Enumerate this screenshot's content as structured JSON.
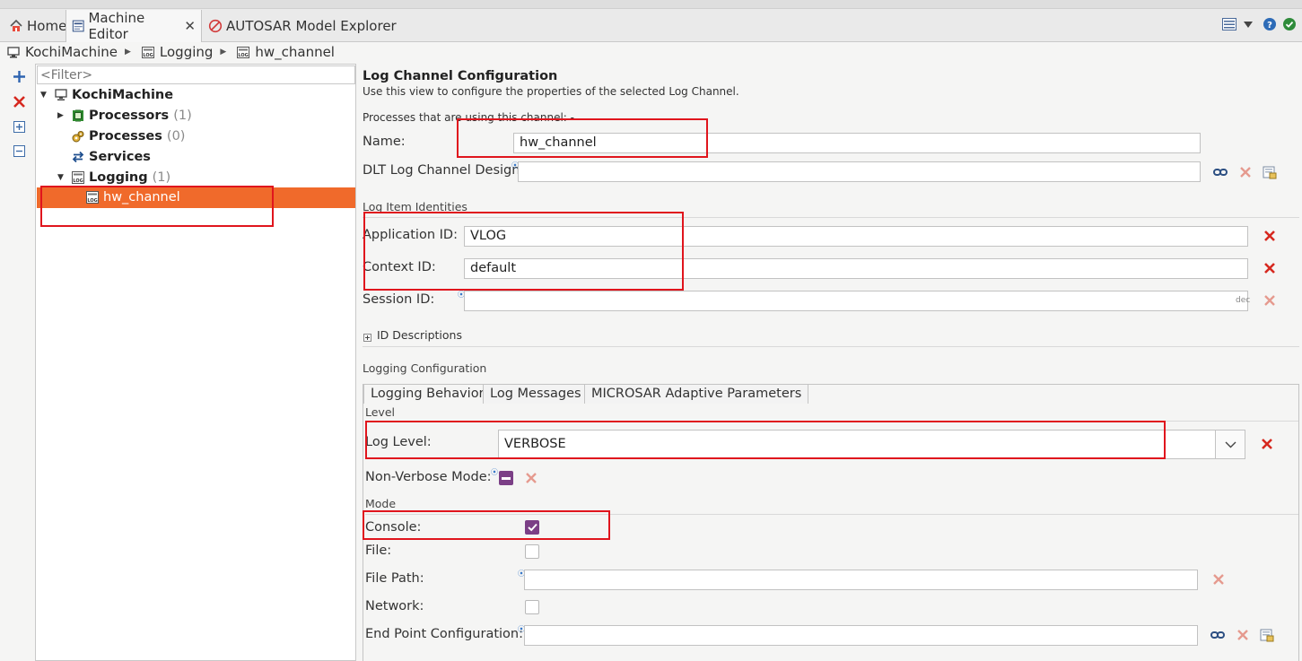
{
  "tabs": [
    {
      "label": "Home",
      "icon": "home-icon"
    },
    {
      "label": "Machine Editor",
      "icon": "machine-editor-icon",
      "close": "✕"
    },
    {
      "label": "AUTOSAR Model Explorer",
      "icon": "autosar-explorer-icon"
    }
  ],
  "breadcrumb": [
    "KochiMachine",
    "Logging",
    "hw_channel"
  ],
  "tree": {
    "filter_placeholder": "<Filter>",
    "root": {
      "label": "KochiMachine"
    },
    "items": [
      {
        "label": "Processors",
        "count": "(1)"
      },
      {
        "label": "Processes",
        "count": "(0)"
      },
      {
        "label": "Services",
        "count": ""
      },
      {
        "label": "Logging",
        "count": "(1)"
      }
    ],
    "selected": {
      "label": "hw_channel"
    }
  },
  "config": {
    "title": "Log Channel Configuration",
    "subtitle": "Use this view to configure the properties of the selected Log Channel.",
    "processes_note": "Processes that are using this channel: -",
    "name_label": "Name:",
    "name_value": "hw_channel",
    "dlt_label": "DLT Log Channel Design:",
    "dlt_value": "",
    "log_item_section": "Log Item Identities",
    "app_id_label": "Application ID:",
    "app_id_value": "VLOG",
    "context_id_label": "Context ID:",
    "context_id_value": "default",
    "session_id_label": "Session ID:",
    "session_id_value": "",
    "session_suffix": "dec",
    "id_descriptions": "ID Descriptions",
    "logging_section": "Logging Configuration"
  },
  "subtabs": [
    "Logging Behavior",
    "Log Messages",
    "MICROSAR Adaptive Parameters"
  ],
  "behavior": {
    "level_section": "Level",
    "log_level_label": "Log Level:",
    "log_level_value": "VERBOSE",
    "non_verbose_label": "Non-Verbose Mode:",
    "mode_section": "Mode",
    "console_label": "Console:",
    "console_checked": true,
    "file_label": "File:",
    "file_checked": false,
    "file_path_label": "File Path:",
    "file_path_value": "",
    "network_label": "Network:",
    "network_checked": false,
    "endpoint_label": "End Point Configuration:",
    "endpoint_value": ""
  },
  "colors": {
    "selection": "#f06a2b",
    "highlight": "#e0151d",
    "checkbox": "#7b3f86",
    "remove": "#d6281f"
  }
}
